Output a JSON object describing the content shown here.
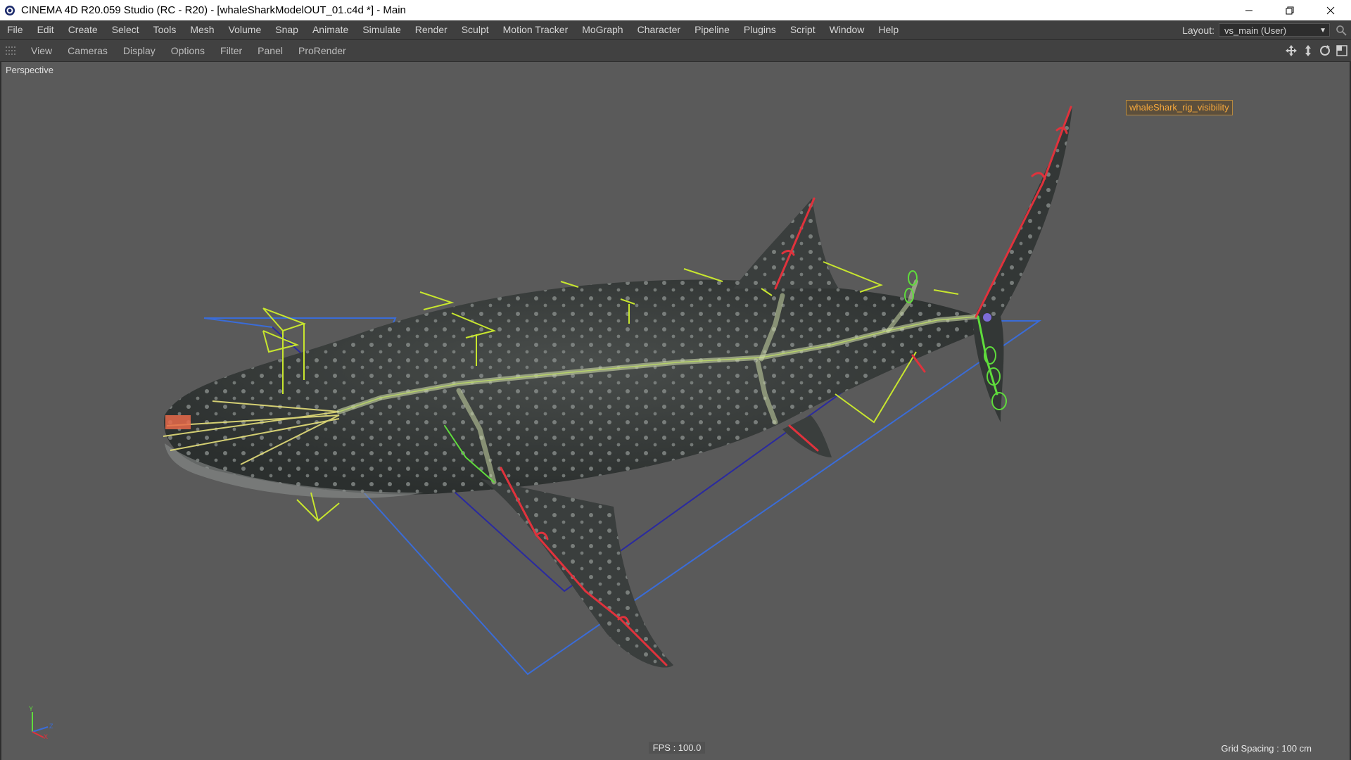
{
  "window": {
    "title": "CINEMA 4D R20.059 Studio (RC - R20) - [whaleSharkModelOUT_01.c4d *] - Main",
    "icons": [
      "app-logo",
      "minimize-icon",
      "restore-icon",
      "close-icon"
    ]
  },
  "menubar": {
    "items": [
      "File",
      "Edit",
      "Create",
      "Select",
      "Tools",
      "Mesh",
      "Volume",
      "Snap",
      "Animate",
      "Simulate",
      "Render",
      "Sculpt",
      "Motion Tracker",
      "MoGraph",
      "Character",
      "Pipeline",
      "Plugins",
      "Script",
      "Window",
      "Help"
    ],
    "layout_label": "Layout:",
    "layout_value": "vs_main (User)"
  },
  "viewport_menu": {
    "items": [
      "View",
      "Cameras",
      "Display",
      "Options",
      "Filter",
      "Panel",
      "ProRender"
    ]
  },
  "viewport": {
    "name": "Perspective",
    "object_label": "whaleShark_rig_visibility",
    "fps": "FPS : 100.0",
    "grid_spacing": "Grid Spacing : 100 cm",
    "axis_labels": [
      "Y",
      "Z",
      "X"
    ]
  },
  "colors": {
    "background": "#5a5a5a",
    "menubar": "#3f3f3f",
    "rig_yellow": "#c8e62e",
    "rig_red": "#e0323c",
    "rig_green": "#5fdc3c",
    "rig_blue": "#3a6cd8",
    "label_orange": "#f7a93d"
  }
}
